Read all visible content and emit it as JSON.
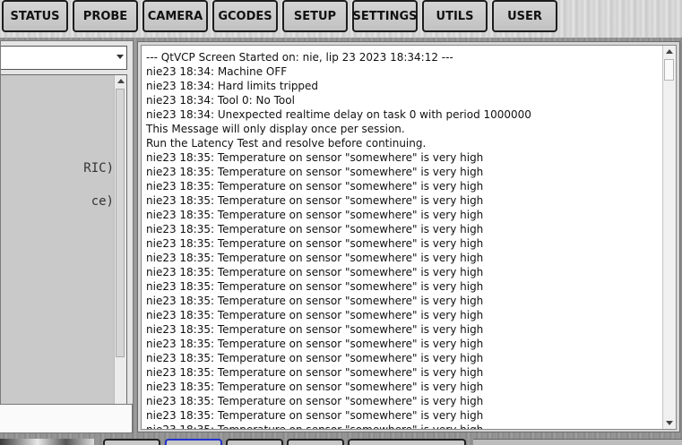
{
  "tabs": [
    {
      "label": "STATUS",
      "active": true
    },
    {
      "label": "PROBE",
      "active": false
    },
    {
      "label": "CAMERA",
      "active": false
    },
    {
      "label": "GCODES",
      "active": false
    },
    {
      "label": "SETUP",
      "active": false
    },
    {
      "label": "SETTINGS",
      "active": false
    },
    {
      "label": "UTILS",
      "active": false
    },
    {
      "label": "USER",
      "active": false
    }
  ],
  "left_panel": {
    "combo_value": "",
    "code_lines": [
      "RIC)",
      "ce)"
    ]
  },
  "log": {
    "lines": [
      "--- QtVCP Screen Started on: nie, lip 23 2023 18:34:12 ---",
      "nie23 18:34: Machine OFF",
      "nie23 18:34: Hard limits tripped",
      "nie23 18:34: Tool 0: No Tool",
      "nie23 18:34: Unexpected realtime delay on task 0 with period 1000000",
      "This Message will only display once per session.",
      "Run the Latency Test and resolve before continuing.",
      "nie23 18:35: Temperature on sensor \"somewhere\" is very high",
      "nie23 18:35: Temperature on sensor \"somewhere\" is very high",
      "nie23 18:35: Temperature on sensor \"somewhere\" is very high",
      "nie23 18:35: Temperature on sensor \"somewhere\" is very high",
      "nie23 18:35: Temperature on sensor \"somewhere\" is very high",
      "nie23 18:35: Temperature on sensor \"somewhere\" is very high",
      "nie23 18:35: Temperature on sensor \"somewhere\" is very high",
      "nie23 18:35: Temperature on sensor \"somewhere\" is very high",
      "nie23 18:35: Temperature on sensor \"somewhere\" is very high",
      "nie23 18:35: Temperature on sensor \"somewhere\" is very high",
      "nie23 18:35: Temperature on sensor \"somewhere\" is very high",
      "nie23 18:35: Temperature on sensor \"somewhere\" is very high",
      "nie23 18:35: Temperature on sensor \"somewhere\" is very high",
      "nie23 18:35: Temperature on sensor \"somewhere\" is very high",
      "nie23 18:35: Temperature on sensor \"somewhere\" is very high",
      "nie23 18:35: Temperature on sensor \"somewhere\" is very high",
      "nie23 18:35: Temperature on sensor \"somewhere\" is very high",
      "nie23 18:35: Temperature on sensor \"somewhere\" is very high",
      "nie23 18:35: Temperature on sensor \"somewhere\" is very high",
      "nie23 18:35: Temperature on sensor \"somewhere\" is very high",
      "nie23 18:35: Temperature on sensor \"somewhere\" is very high"
    ]
  },
  "colors": {
    "active_tab": "#2233dd",
    "tab_border": "#1c1c1c",
    "log_background": "#ffffff"
  }
}
